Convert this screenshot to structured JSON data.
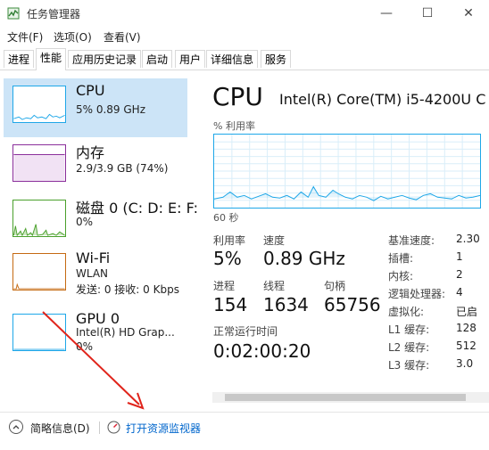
{
  "window": {
    "title": "任务管理器",
    "minimize_glyph": "—",
    "maximize_glyph": "☐",
    "close_glyph": "✕"
  },
  "menu": [
    "文件(F)",
    "选项(O)",
    "查看(V)"
  ],
  "tabs": [
    {
      "label": "进程",
      "active": false
    },
    {
      "label": "性能",
      "active": true
    },
    {
      "label": "应用历史记录",
      "active": false
    },
    {
      "label": "启动",
      "active": false
    },
    {
      "label": "用户",
      "active": false
    },
    {
      "label": "详细信息",
      "active": false
    },
    {
      "label": "服务",
      "active": false
    }
  ],
  "sidebar": [
    {
      "name": "CPU",
      "line1": "5% 0.89 GHz",
      "line2": "",
      "color": "#1ea7e8"
    },
    {
      "name": "内存",
      "line1": "2.9/3.9 GB (74%)",
      "line2": "",
      "color": "#8b2f9b"
    },
    {
      "name": "磁盘 0 (C: D: E: F:",
      "line1": "0%",
      "line2": "",
      "color": "#4aa02c"
    },
    {
      "name": "Wi-Fi",
      "line1": "WLAN",
      "line2": "发送: 0 接收: 0 Kbps",
      "color": "#c56a12"
    },
    {
      "name": "GPU 0",
      "line1": "Intel(R) HD Grap...",
      "line2": "0%",
      "color": "#1ea7e8"
    }
  ],
  "main": {
    "title": "CPU",
    "model": "Intel(R) Core(TM) i5-4200U C",
    "graph_label": "% 利用率",
    "graph_time": "60 秒",
    "stats": {
      "util_label": "利用率",
      "util_value": "5%",
      "speed_label": "速度",
      "speed_value": "0.89 GHz",
      "proc_label": "进程",
      "proc_value": "154",
      "threads_label": "线程",
      "threads_value": "1634",
      "handles_label": "句柄",
      "handles_value": "65756",
      "uptime_label": "正常运行时间",
      "uptime_value": "0:02:00:20"
    },
    "details": [
      {
        "label": "基准速度:",
        "value": "2.30"
      },
      {
        "label": "插槽:",
        "value": "1"
      },
      {
        "label": "内核:",
        "value": "2"
      },
      {
        "label": "逻辑处理器:",
        "value": "4"
      },
      {
        "label": "虚拟化:",
        "value": "已启"
      },
      {
        "label": "L1 缓存:",
        "value": "128"
      },
      {
        "label": "L2 缓存:",
        "value": "512"
      },
      {
        "label": "L3 缓存:",
        "value": "3.0"
      }
    ]
  },
  "bottom": {
    "less_details": "简略信息(D)",
    "resource_monitor": "打开资源监视器"
  },
  "colors": {
    "accent": "#1ea7e8",
    "selected": "#cce4f7",
    "arrow": "#e0241b",
    "link": "#0066cc"
  }
}
